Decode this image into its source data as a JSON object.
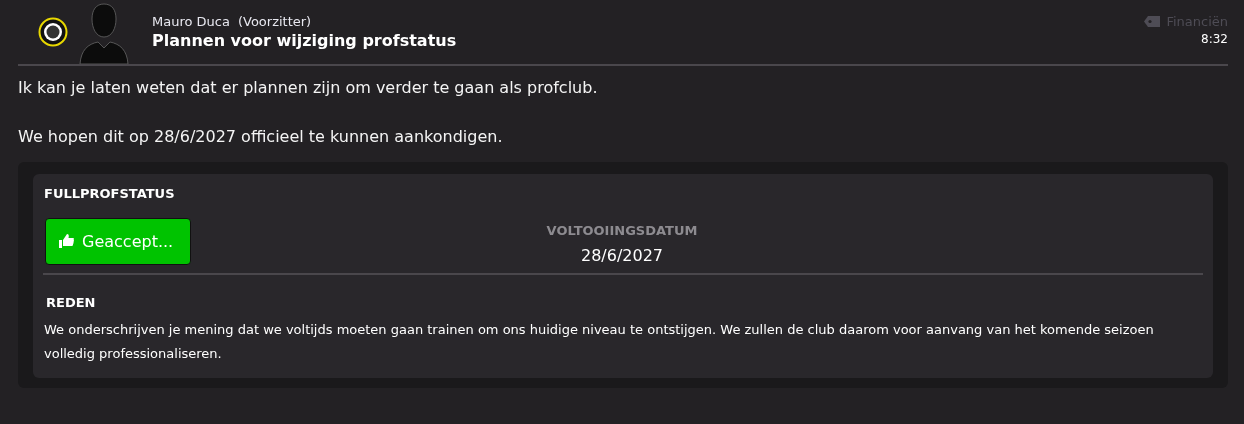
{
  "message": {
    "sender": "Mauro Duca",
    "role": "(Voorzitter)",
    "subject": "Plannen voor wijziging profstatus",
    "category": "Financiën",
    "time": "8:32"
  },
  "body": [
    "Ik kan je laten weten dat er plannen zijn om verder te gaan als profclub.",
    "We hopen dit op 28/6/2027 officieel te kunnen aankondigen."
  ],
  "panel": {
    "title": "FULLPROFSTATUS",
    "status": {
      "label": "Geaccept...",
      "kind": "accepted"
    },
    "date_label": "VOLTOOIINGSDATUM",
    "date": "28/6/2027",
    "reason_title": "REDEN",
    "reason": "We onderschrijven je mening dat we voltijds moeten gaan trainen om ons huidige niveau te ontstijgen. We zullen de club daarom voor aanvang van het komende seizoen volledig professionaliseren."
  }
}
